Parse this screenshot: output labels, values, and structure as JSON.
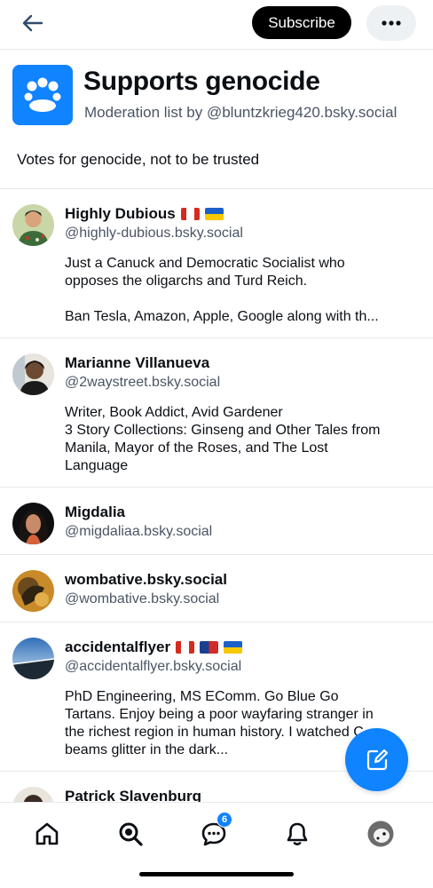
{
  "header": {
    "subscribe_label": "Subscribe"
  },
  "list": {
    "title": "Supports genocide",
    "subtitle": "Moderation list by @bluntzkrieg420.bsky.social",
    "description": "Votes for genocide, not to be trusted"
  },
  "members": [
    {
      "name": "Highly Dubious",
      "flags": [
        "canada-flag",
        "ukraine-flag"
      ],
      "handle": "@highly-dubious.bsky.social",
      "bio_lines": [
        "Just a Canuck and Democratic Socialist who",
        "opposes the oligarchs and Turd Reich.",
        "",
        "Ban Tesla, Amazon, Apple, Google along with th..."
      ]
    },
    {
      "name": "Marianne Villanueva",
      "flags": [],
      "handle": "@2waystreet.bsky.social",
      "bio_lines": [
        "Writer, Book Addict, Avid Gardener",
        "3 Story Collections: Ginseng and Other Tales from",
        "Manila, Mayor of the Roses, and The Lost",
        "Language"
      ]
    },
    {
      "name": "Migdalia",
      "flags": [],
      "handle": "@migdaliaa.bsky.social",
      "bio_lines": []
    },
    {
      "name": "wombative.bsky.social",
      "flags": [],
      "handle": "@wombative.bsky.social",
      "bio_lines": []
    },
    {
      "name": "accidentalflyer",
      "flags": [
        "canada-flag",
        "taiwan-flag",
        "ukraine-flag"
      ],
      "handle": "@accidentalflyer.bsky.social",
      "bio_lines": [
        "PhD Engineering, MS EComm. Go Blue Go",
        "Tartans. Enjoy being a poor wayfaring stranger in",
        "the richest region in human history. I watched C-",
        "beams glitter in the dark..."
      ]
    },
    {
      "name": "Patrick Slavenburg",
      "flags": [],
      "handle": "",
      "bio_lines": []
    }
  ],
  "nav": {
    "items": [
      "home-icon",
      "search-icon",
      "chat-icon",
      "bell-icon",
      "profile-avatar"
    ],
    "chat_badge": "6"
  },
  "colors": {
    "accent": "#1083fe",
    "text": "#0b0f14",
    "muted": "#4a5564",
    "divider": "#e6e9ee"
  }
}
